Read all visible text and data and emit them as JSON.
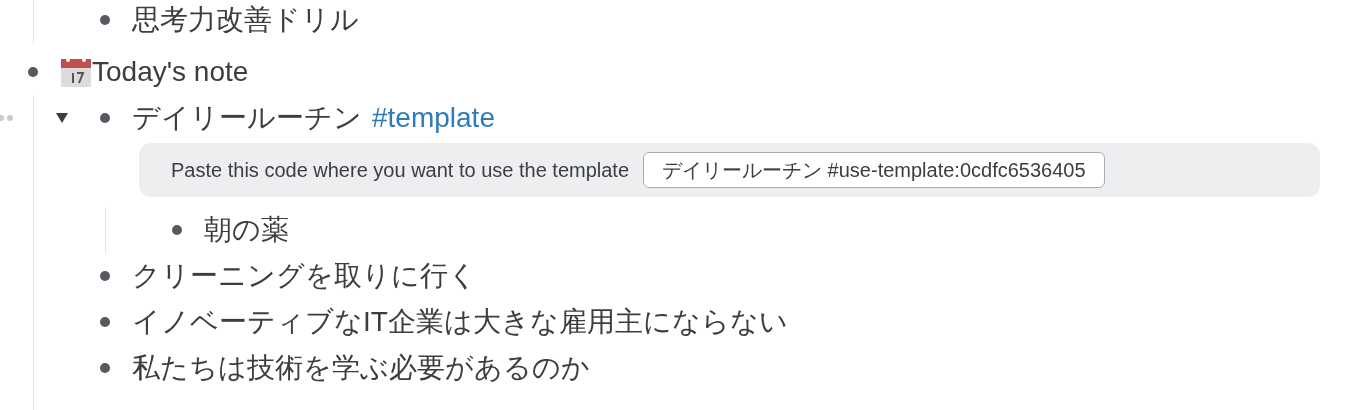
{
  "outline": {
    "continued_children": [
      {
        "text": "思考力改善ドリル"
      }
    ],
    "items": [
      {
        "text": "Today's note",
        "kind": "dated",
        "children": [
          {
            "text": "デイリールーチン",
            "tag": "#template",
            "expanded": true,
            "hovered": true,
            "template_hint": {
              "label": "Paste this code where you want to use the template",
              "code": "デイリールーチン #use-template:0cdfc6536405"
            },
            "children": [
              {
                "text": "朝の薬"
              }
            ]
          },
          {
            "text": "クリーニングを取りに行く"
          },
          {
            "text": "イノベーティブなIT企業は大きな雇用主にならない"
          },
          {
            "text": "私たちは技術を学ぶ必要があるのか"
          }
        ]
      }
    ]
  }
}
